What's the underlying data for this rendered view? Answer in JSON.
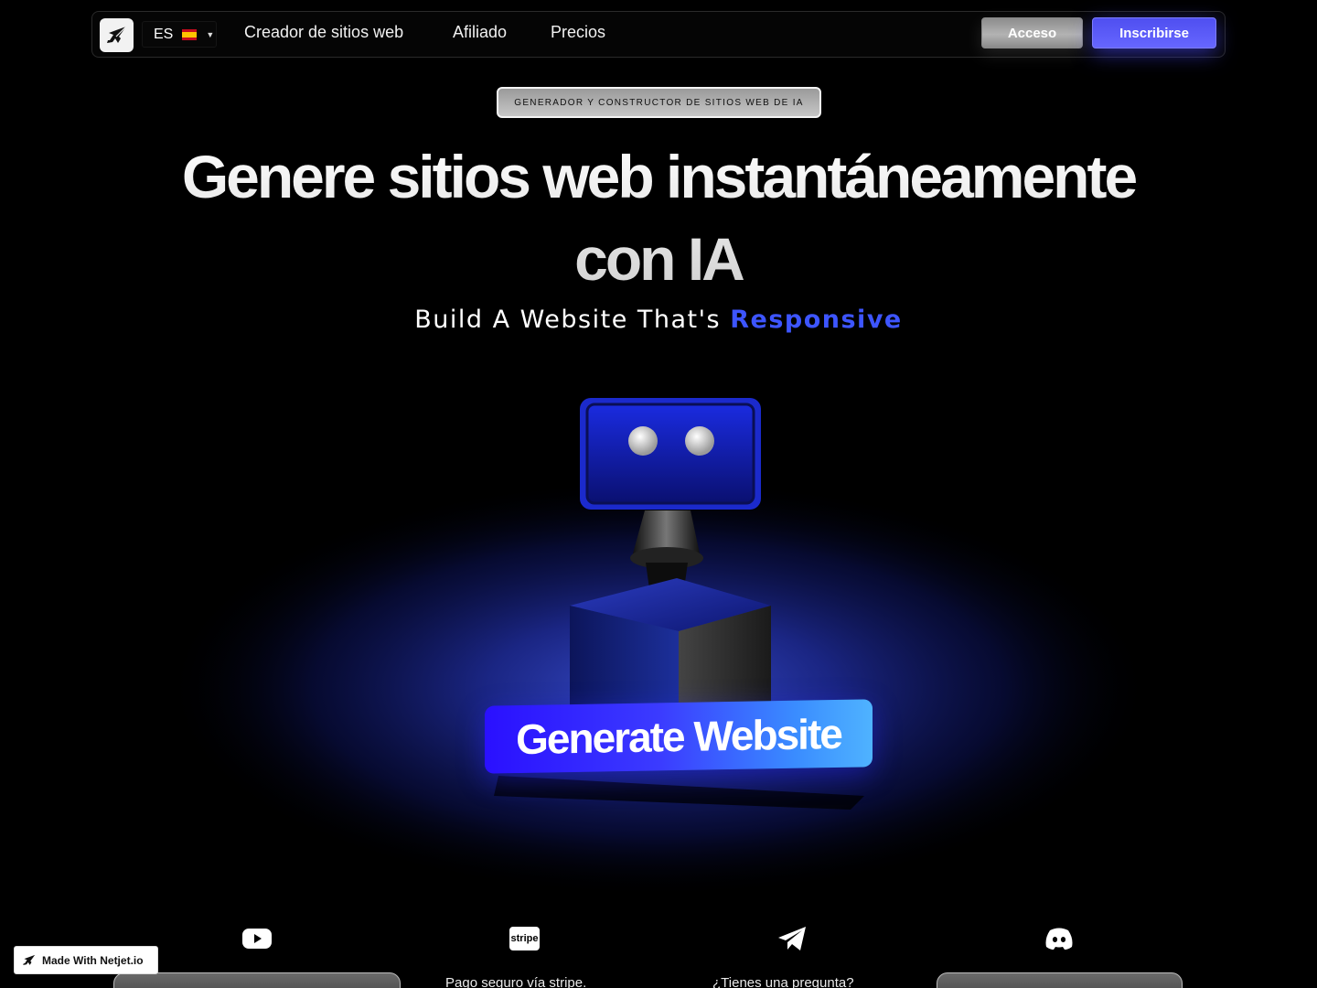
{
  "nav": {
    "logo_icon": "jet-plane-icon",
    "language": {
      "code": "ES",
      "flag": "spain-flag-icon"
    },
    "links": [
      "Creador de sitios web",
      "Afiliado",
      "Precios"
    ],
    "login_label": "Acceso",
    "signup_label": "Inscribirse"
  },
  "hero": {
    "badge": "GENERADOR Y CONSTRUCTOR DE SITIOS WEB DE IA",
    "title_line1": "Genere sitios web instantáneamente",
    "title_line2": "con IA",
    "subtitle_prefix": "Build A Website That's",
    "subtitle_accent": "Responsive",
    "accent_color": "#3d55ff"
  },
  "cta": {
    "label": "Generate Website"
  },
  "features": [
    {
      "icon": "youtube-icon",
      "text": ""
    },
    {
      "icon": "stripe-icon",
      "icon_text": "stripe",
      "text": "Pago seguro vía stripe."
    },
    {
      "icon": "telegram-icon",
      "text": "¿Tienes una pregunta?"
    },
    {
      "icon": "discord-icon",
      "text": ""
    }
  ],
  "made_with": "Made With Netjet.io"
}
